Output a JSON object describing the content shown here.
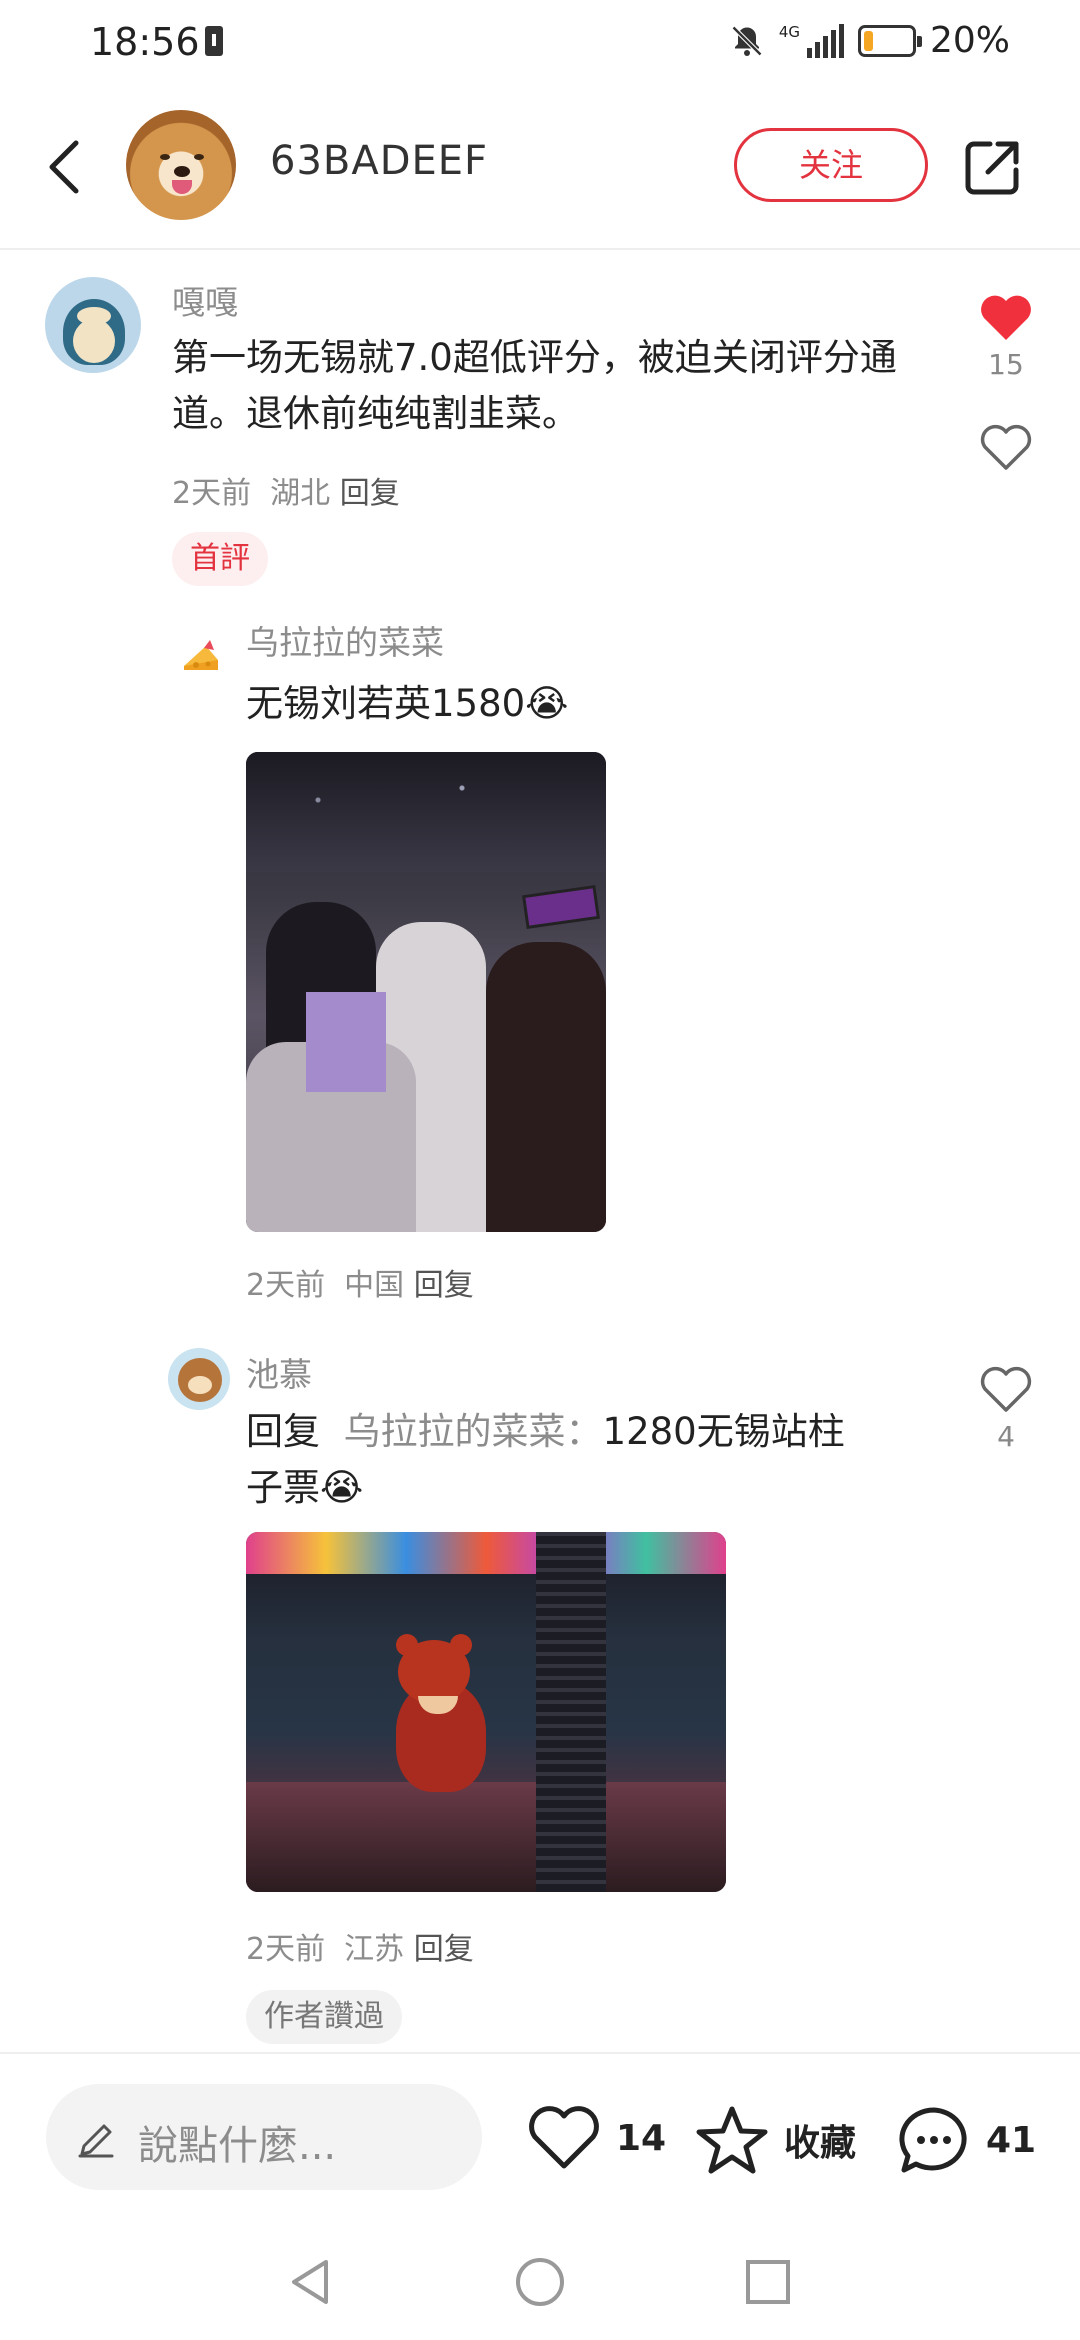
{
  "status_bar": {
    "time": "18:56",
    "network": "4G",
    "battery_percent": "20%",
    "battery_level": 0.2
  },
  "header": {
    "username": "63BADEEF",
    "follow_label": "关注"
  },
  "comments": [
    {
      "author": "嘎嘎",
      "text": "第一场无锡就7.0超低评分，被迫关闭评分通道。退休前纯纯割韭菜。",
      "time": "2天前",
      "location": "湖北",
      "reply_label": "回复",
      "likes": "15",
      "liked": true,
      "tag": "首評"
    },
    {
      "author": "乌拉拉的菜菜",
      "text": "无锡刘若英1580",
      "emoji": "😭",
      "time": "2天前",
      "location": "中国",
      "reply_label": "回复",
      "likes": "",
      "liked": false
    },
    {
      "author": "池慕",
      "reply_prefix": "回复",
      "reply_to": "乌拉拉的菜菜：",
      "text_line1": "1280无锡站柱",
      "text_line2": "子票",
      "emoji": "😭",
      "time": "2天前",
      "location": "江苏",
      "reply_label": "回复",
      "likes": "4",
      "liked": false,
      "tag": "作者讚過"
    }
  ],
  "bottom_bar": {
    "input_placeholder": "說點什麼...",
    "like_count": "14",
    "favorite_label": "收藏",
    "comment_count": "41"
  },
  "colors": {
    "accent": "#e3333f",
    "meta_text": "#8c8c8c",
    "divider": "#eeeeee"
  }
}
